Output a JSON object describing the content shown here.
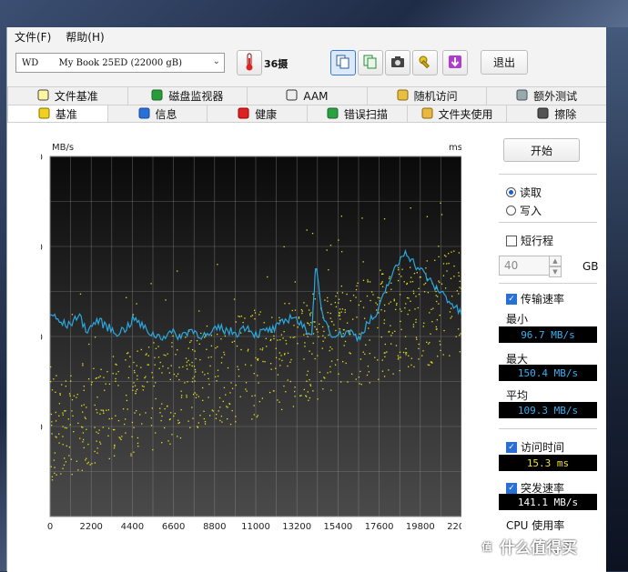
{
  "menu": {
    "file": "文件(F)",
    "help": "帮助(H)"
  },
  "toolbar": {
    "drive_value": "WD       My Book 25ED (22000 gB)",
    "temperature": "36摄",
    "exit_label": "退出"
  },
  "tabs_row1": [
    "文件基准",
    "磁盘监视器",
    "AAM",
    "随机访问",
    "额外测试"
  ],
  "tabs_row2": [
    "基准",
    "信息",
    "健康",
    "错误扫描",
    "文件夹使用",
    "擦除"
  ],
  "side": {
    "start_label": "开始",
    "read_label": "读取",
    "write_label": "写入",
    "short_stroke_label": "短行程",
    "short_stroke_value": "40",
    "gb_unit": "GB",
    "transfer_rate_label": "传输速率",
    "min_label": "最小",
    "min_value": "96.7 MB/s",
    "max_label": "最大",
    "max_value": "150.4 MB/s",
    "avg_label": "平均",
    "avg_value": "109.3 MB/s",
    "access_time_label": "访问时间",
    "access_time_value": "15.3 ms",
    "burst_label": "突发速率",
    "burst_value": "141.1 MB/s",
    "cpu_label": "CPU 使用率"
  },
  "colors": {
    "read_line": "#2aa8e0",
    "access_points": "#e8e020",
    "accent": "#2a6fd6"
  },
  "watermark": "什么值得买",
  "chart_data": {
    "type": "line",
    "xlabel": "",
    "ylabel_left": "MB/s",
    "ylabel_right": "ms",
    "x_ticks": [
      "0",
      "2200",
      "4400",
      "6600",
      "8800",
      "11000",
      "13200",
      "15400",
      "17600",
      "19800",
      "22000"
    ],
    "y_left_ticks": [
      "200",
      "150",
      "100",
      "50"
    ],
    "y_right_ticks": [
      "40",
      "30",
      "20",
      "10"
    ],
    "xlim": [
      0,
      22000
    ],
    "ylim_left": [
      0,
      200
    ],
    "ylim_right": [
      0,
      40
    ],
    "grid": true,
    "series": [
      {
        "name": "传输速率",
        "unit": "MB/s",
        "x": [
          0,
          500,
          1000,
          1500,
          2000,
          2500,
          3000,
          3500,
          4000,
          4500,
          5000,
          5500,
          6000,
          6500,
          7000,
          7500,
          8000,
          8500,
          9000,
          9500,
          10000,
          10500,
          11000,
          11500,
          12000,
          12500,
          13000,
          13500,
          14000,
          14200,
          14500,
          15000,
          15500,
          16000,
          16500,
          17000,
          17500,
          18000,
          18500,
          19000,
          19500,
          20000,
          20500,
          21000,
          21500,
          22000
        ],
        "values": [
          113,
          108,
          106,
          112,
          103,
          109,
          106,
          102,
          104,
          110,
          105,
          101,
          100,
          102,
          100,
          104,
          101,
          100,
          105,
          103,
          102,
          106,
          101,
          103,
          104,
          108,
          112,
          105,
          102,
          140,
          115,
          102,
          101,
          103,
          99,
          108,
          112,
          128,
          138,
          148,
          140,
          135,
          128,
          124,
          118,
          112
        ]
      },
      {
        "name": "访问时间",
        "unit": "ms",
        "type": "scatter",
        "x_range": [
          0,
          22000
        ],
        "trend_start": 10,
        "trend_end": 24,
        "spread": 6
      }
    ]
  }
}
